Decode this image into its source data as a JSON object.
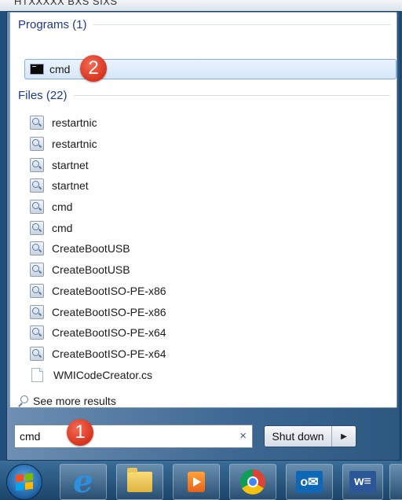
{
  "background": {
    "top_text": "HTXXXXX     BXS SIXS"
  },
  "start_menu": {
    "programs_header": "Programs (1)",
    "program_item": {
      "label": "cmd",
      "icon": "cmd-icon"
    },
    "files_header": "Files (22)",
    "files": [
      {
        "label": "restartnic",
        "icon": "file-search-icon"
      },
      {
        "label": "restartnic",
        "icon": "file-search-icon"
      },
      {
        "label": "startnet",
        "icon": "file-search-icon"
      },
      {
        "label": "startnet",
        "icon": "file-search-icon"
      },
      {
        "label": "cmd",
        "icon": "file-search-icon"
      },
      {
        "label": "cmd",
        "icon": "file-search-icon"
      },
      {
        "label": "CreateBootUSB",
        "icon": "file-search-icon"
      },
      {
        "label": "CreateBootUSB",
        "icon": "file-search-icon"
      },
      {
        "label": "CreateBootISO-PE-x86",
        "icon": "file-search-icon"
      },
      {
        "label": "CreateBootISO-PE-x86",
        "icon": "file-search-icon"
      },
      {
        "label": "CreateBootISO-PE-x64",
        "icon": "file-search-icon"
      },
      {
        "label": "CreateBootISO-PE-x64",
        "icon": "file-search-icon"
      },
      {
        "label": "WMICodeCreator.cs",
        "icon": "document-icon"
      }
    ],
    "see_more": "See more results",
    "search": {
      "value": "cmd",
      "clear": "×"
    },
    "shutdown": {
      "label": "Shut down",
      "arrow": "▶"
    }
  },
  "callouts": {
    "one": "1",
    "two": "2"
  },
  "taskbar": {
    "items": [
      "start-button",
      "internet-explorer",
      "file-explorer",
      "media-player",
      "chrome",
      "outlook",
      "word"
    ],
    "outlook_text": "o✉",
    "word_text": "w≡"
  },
  "colors": {
    "accent": "#1e3a8a",
    "highlight": "#d7e7f9",
    "callout": "#d8331e"
  }
}
